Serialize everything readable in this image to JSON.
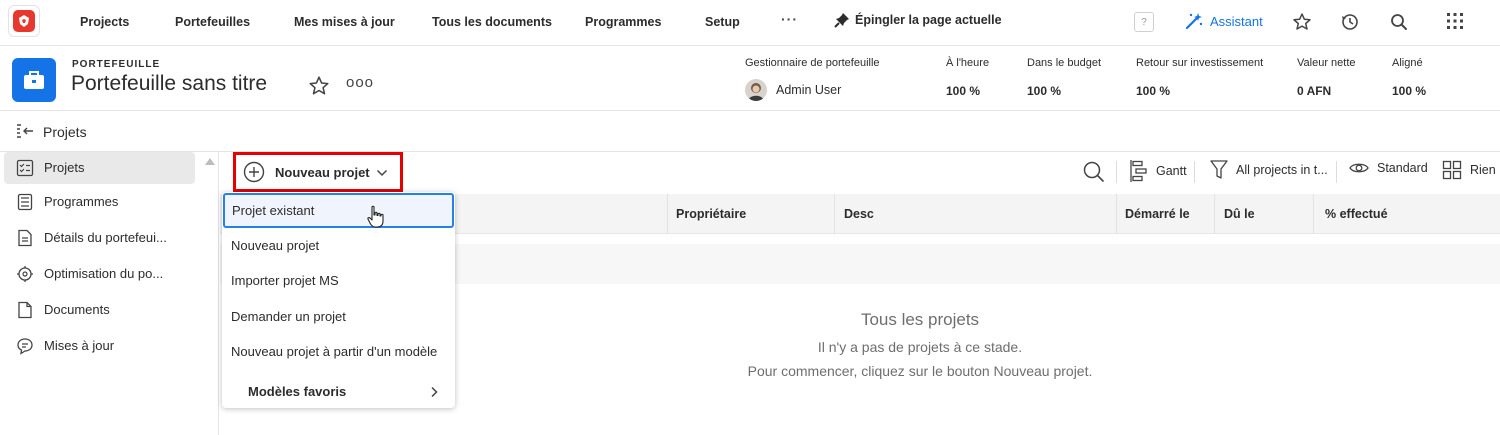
{
  "topnav": {
    "items": [
      "Projects",
      "Portefeuilles",
      "Mes mises à jour",
      "Tous les documents",
      "Programmes",
      "Setup"
    ],
    "more": "···",
    "pin_label": "Épingler la page actuelle",
    "help": "?",
    "assistant_label": "Assistant",
    "icons": [
      "star-icon",
      "history-icon",
      "search-icon",
      "apps-grid-icon"
    ]
  },
  "portfolio": {
    "kicker": "PORTEFEUILLE",
    "title": "Portefeuille sans titre",
    "more": "ooo",
    "manager_label": "Gestionnaire de portefeuille",
    "manager_name": "Admin User",
    "metrics": [
      {
        "label": "À l'heure",
        "value": "100 %"
      },
      {
        "label": "Dans le budget",
        "value": "100 %"
      },
      {
        "label": "Retour sur investissement",
        "value": "100 %"
      },
      {
        "label": "Valeur nette",
        "value": "0 AFN"
      },
      {
        "label": "Aligné",
        "value": "100 %"
      }
    ]
  },
  "section": {
    "title": "Projets"
  },
  "sidebar": {
    "items": [
      {
        "label": "Projets",
        "active": true
      },
      {
        "label": "Programmes"
      },
      {
        "label": "Détails du portefeui..."
      },
      {
        "label": "Optimisation du po..."
      },
      {
        "label": "Documents"
      },
      {
        "label": "Mises à jour"
      }
    ]
  },
  "toolbar": {
    "new_project_label": "Nouveau projet",
    "gantt_label": "Gantt",
    "filter_label": "All projects in t...",
    "view_label": "Standard",
    "group_label": "Rien"
  },
  "table": {
    "columns": [
      "Propriétaire",
      "Desc",
      "Démarré le",
      "Dû le",
      "% effectué"
    ]
  },
  "empty_state": {
    "title": "Tous les projets",
    "line1": "Il n'y a pas de projets à ce stade.",
    "line2": "Pour commencer, cliquez sur le bouton Nouveau projet."
  },
  "dropdown": {
    "items": [
      "Projet existant",
      "Nouveau projet",
      "Importer projet MS",
      "Demander un projet",
      "Nouveau projet à partir d'un modèle"
    ],
    "favorites_label": "Modèles favoris"
  },
  "colors": {
    "accent": "#1473e6",
    "highlight_box": "#e60000",
    "brand": "#e8372c"
  }
}
